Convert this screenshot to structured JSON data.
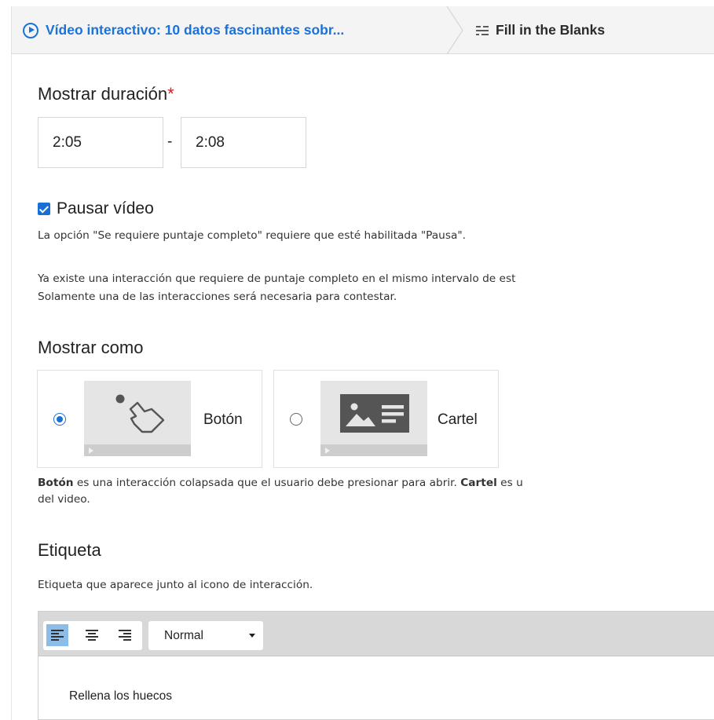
{
  "breadcrumb": {
    "video_title": "Vídeo interactivo: 10 datos fascinantes sobr...",
    "current": "Fill in the Blanks"
  },
  "duration": {
    "label": "Mostrar duración",
    "required_mark": "*",
    "start": "2:05",
    "separator": "-",
    "end": "2:08"
  },
  "pause": {
    "checked": true,
    "label": "Pausar vídeo",
    "note": "La opción \"Se requiere puntaje completo\" requiere que esté habilitada \"Pausa\".",
    "warning_line1": "Ya existe una interacción que requiere de puntaje completo en el mismo intervalo de est",
    "warning_line2": "Solamente una de las interacciones será necesaria para contestar."
  },
  "display_as": {
    "label": "Mostrar como",
    "options": [
      {
        "label": "Botón",
        "selected": true,
        "icon": "pointer-hand-icon"
      },
      {
        "label": "Cartel",
        "selected": false,
        "icon": "poster-card-icon"
      }
    ],
    "help": {
      "b1": "Botón",
      "t1": " es una interacción colapsada que el usuario debe presionar para abrir. ",
      "b2": "Cartel",
      "t2": " es u",
      "line2": "del video."
    }
  },
  "label_field": {
    "label": "Etiqueta",
    "description": "Etiqueta que aparece junto al icono de interacción.",
    "editor": {
      "format": "Normal",
      "alignment": "left",
      "content": "Rellena los huecos"
    }
  },
  "colors": {
    "accent": "#1a73d9",
    "required": "#d42020",
    "toolbar": "#d8d8d8",
    "active_align": "#8bbde8"
  }
}
